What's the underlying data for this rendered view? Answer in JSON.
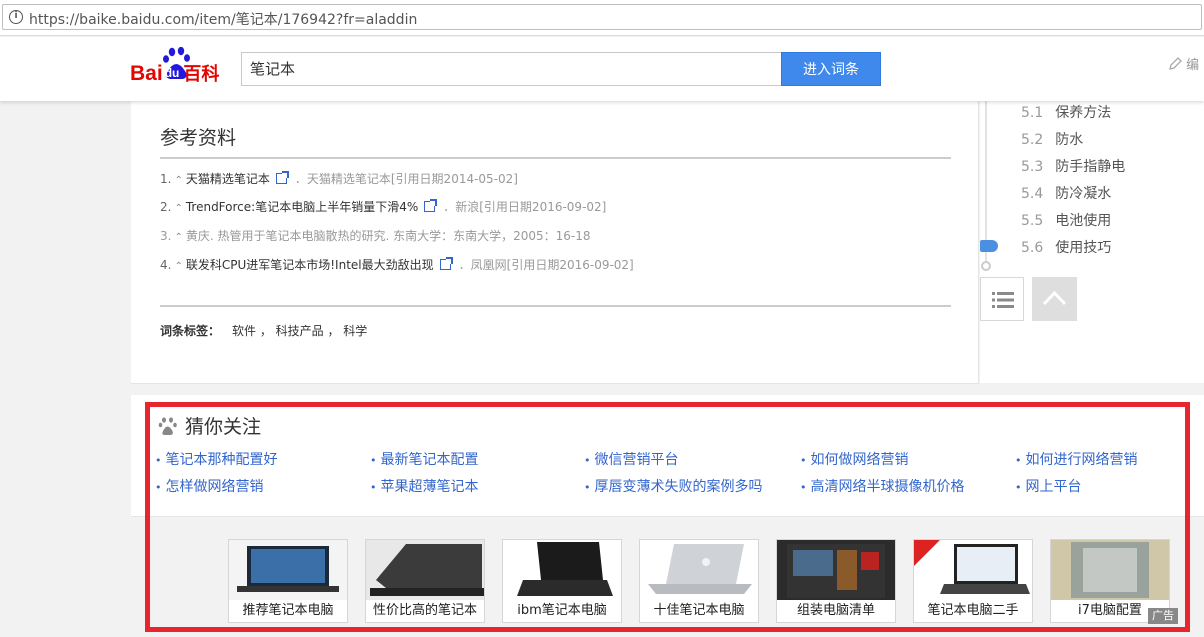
{
  "browser": {
    "url": "https://baike.baidu.com/item/笔记本/176942?fr=aladdin"
  },
  "header": {
    "logo_text_bai": "Bai",
    "logo_text_du": "du",
    "logo_text_baike": "百科",
    "search_value": "笔记本",
    "search_button": "进入词条",
    "edit_label": "编"
  },
  "references": {
    "title": "参考资料",
    "items": [
      {
        "num": "1.",
        "title": "天猫精选笔记本",
        "source": "天猫精选笔记本[引用日期2014-05-02]"
      },
      {
        "num": "2.",
        "title": "TrendForce:笔记本电脑上半年销量下滑4%",
        "source": "新浪[引用日期2016-09-02]"
      },
      {
        "num": "3.",
        "text": "黄庆. 热管用于笔记本电脑散热的研究. 东南大学：东南大学，2005：16-18"
      },
      {
        "num": "4.",
        "title": "联发科CPU进军笔记本市场!Intel最大劲敌出现",
        "source": "凤凰网[引用日期2016-09-02]"
      }
    ],
    "separator": "．"
  },
  "tags": {
    "label": "词条标签：",
    "values": "软件 ， 科技产品 ， 科学"
  },
  "sidebar": {
    "items": [
      {
        "num": "5.1",
        "label": "保养方法"
      },
      {
        "num": "5.2",
        "label": "防水"
      },
      {
        "num": "5.3",
        "label": "防手指静电"
      },
      {
        "num": "5.4",
        "label": "防冷凝水"
      },
      {
        "num": "5.5",
        "label": "电池使用"
      },
      {
        "num": "5.6",
        "label": "使用技巧"
      }
    ]
  },
  "guess": {
    "title": "猜你关注",
    "links": [
      "笔记本那种配置好",
      "最新笔记本配置",
      "微信营销平台",
      "如何做网络营销",
      "如何进行网络营销",
      "怎样做网络营销",
      "苹果超薄笔记本",
      "厚唇变薄术失败的案例多吗",
      "高清网络半球摄像机价格",
      "网上平台"
    ]
  },
  "products": [
    "推荐笔记本电脑",
    "性价比高的笔记本",
    "ibm笔记本电脑",
    "十佳笔记本电脑",
    "组装电脑清单",
    "笔记本电脑二手",
    "i7电脑配置"
  ],
  "ad_badge": "广告",
  "colors": {
    "brand_red": "#e10601",
    "brand_blue": "#2319dc",
    "button_blue": "#3f89ec",
    "link_blue": "#3366cc",
    "highlight_red": "#e8242c"
  }
}
